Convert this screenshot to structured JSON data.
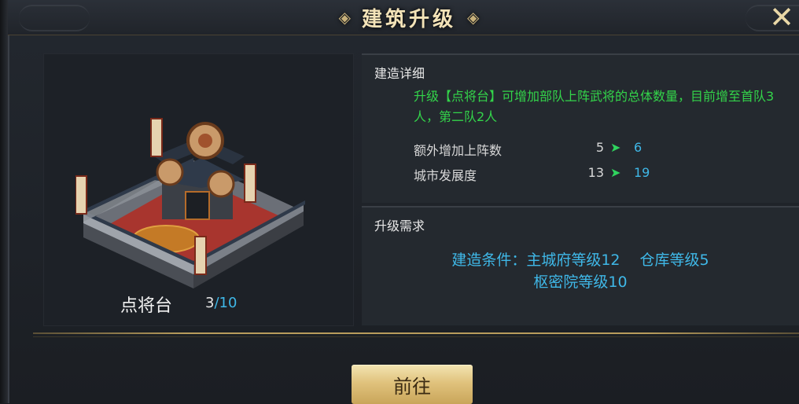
{
  "header": {
    "title": "建筑升级",
    "close_icon": "close-x-icon"
  },
  "building": {
    "name": "点将台",
    "level_current": "3",
    "level_max": "10",
    "image_icon": "command-platform-building-illustration"
  },
  "detail": {
    "title": "建造详细",
    "description": "升级【点将台】可增加部队上阵武将的总体数量，目前增至首队3人，第二队2人",
    "stats": [
      {
        "label": "额外增加上阵数",
        "old": "5",
        "new": "6"
      },
      {
        "label": "城市发展度",
        "old": "13",
        "new": "19"
      }
    ]
  },
  "requirements": {
    "title": "升级需求",
    "line1": "建造条件：主城府等级12　 仓库等级5",
    "line2": "枢密院等级10"
  },
  "actions": {
    "go_label": "前往"
  },
  "colors": {
    "title_gold": "#f3e3b8",
    "desc_green": "#33d44a",
    "value_blue": "#3fb8e8",
    "arrow_green": "#2fd45e",
    "button_gold": "#e0c27c"
  }
}
